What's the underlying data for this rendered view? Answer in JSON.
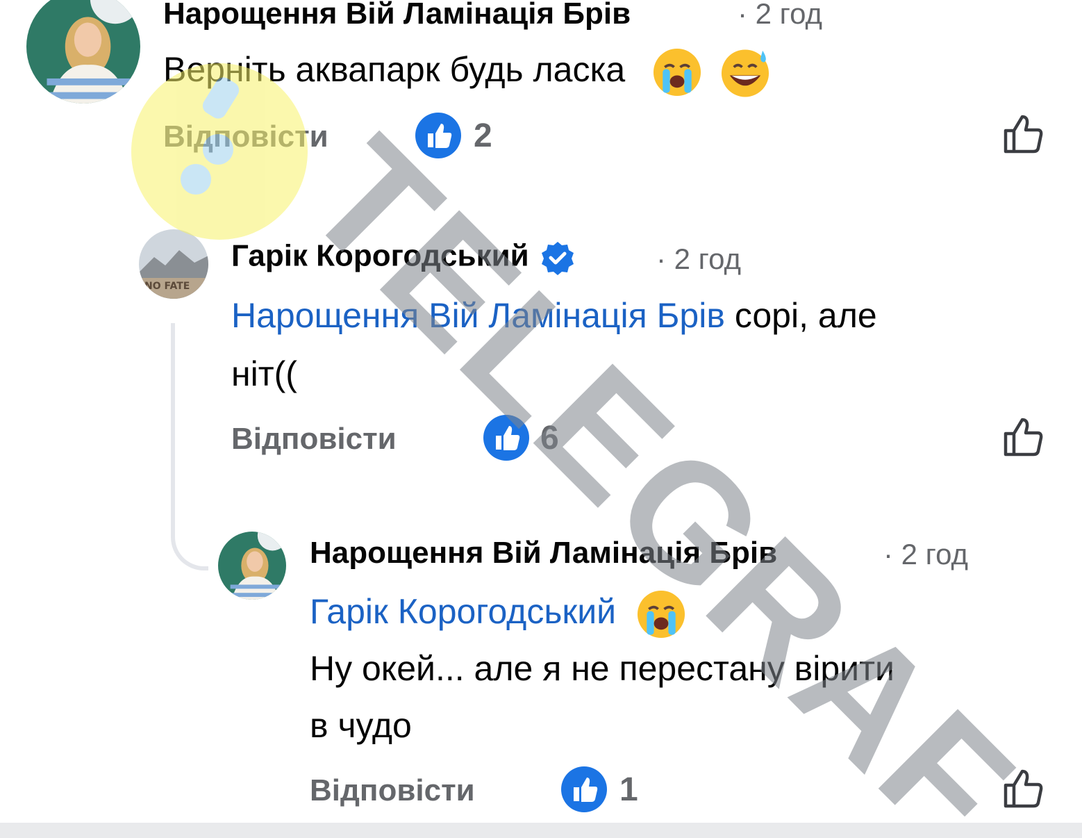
{
  "comments": [
    {
      "author": "Нарощення Вій Ламінація Брів",
      "time": "· 2 год",
      "text": "Верніть аквапарк будь ласка",
      "emoji": [
        "loudly-crying-face",
        "grinning-face-with-sweat"
      ],
      "reply_label": "Відповісти",
      "likes": "2"
    },
    {
      "author": "Гарік Корогодський",
      "verified": true,
      "time": "· 2 год",
      "mention": "Нарощення Вій Ламінація Брів",
      "text_line1": " сорі, але",
      "text_line2": "ніт((",
      "reply_label": "Відповісти",
      "likes": "6"
    },
    {
      "author": "Нарощення Вій Ламінація Брів",
      "time": "· 2 год",
      "mention": "Гарік Корогодський",
      "emoji": [
        "loudly-crying-face"
      ],
      "text_line1": "Ну окей... але я не перестану вірити",
      "text_line2": "в чудо",
      "reply_label": "Відповісти",
      "likes": "1"
    }
  ],
  "watermark": {
    "text": "TELEGRAF",
    "color": "#7f858c",
    "logo_color": "#f7f26a",
    "logo_dot_color": "#9fd3ee"
  },
  "colors": {
    "accent": "#1b74e4",
    "mention": "#1b62c4",
    "secondary_text": "#65676b"
  }
}
